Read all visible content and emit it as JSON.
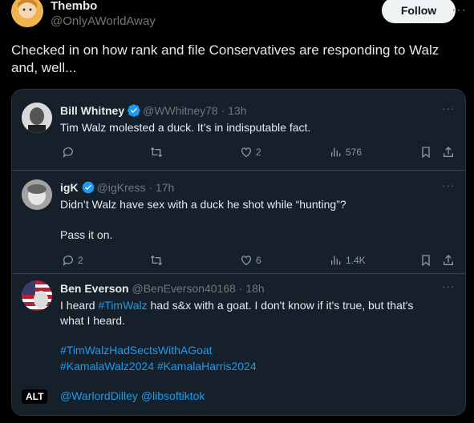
{
  "author": {
    "name": "Thembo",
    "handle": "@OnlyAWorldAway",
    "follow_label": "Follow",
    "more_label": "···"
  },
  "post": {
    "text_line1": "Checked in on how rank and file Conservatives are responding to Walz",
    "text_line2": "and, well..."
  },
  "replies": [
    {
      "name": "Bill Whitney",
      "handle": "@WWhitney78",
      "time": "· 13h",
      "verified": true,
      "lines": [
        "Tim Walz molested a duck. It’s in indisputable fact."
      ],
      "stats": {
        "likes": "2",
        "views": "576"
      }
    },
    {
      "name": "igK",
      "handle": "@igKress",
      "time": "· 17h",
      "verified": true,
      "lines": [
        "Didn’t Walz have sex with a duck he shot while “hunting”?",
        "Pass it on."
      ],
      "stats": {
        "replies": "2",
        "likes": "6",
        "views": "1.4K"
      }
    },
    {
      "name": "Ben Everson",
      "handle": "@BenEverson40168",
      "time": "· 18h",
      "verified": false,
      "line1_pre": "I heard ",
      "line1_tag": "#TimWalz",
      "line1_post": " had s&x with a goat. I don't know if it's true, but that's",
      "line2": "what I heard.",
      "tags_line1": "#TimWalzHadSectsWithAGoat",
      "tags_line2": "#KamalaWalz2024 #KamalaHarris2024",
      "mentions": "@WarlordDilley @libsoftiktok"
    }
  ],
  "alt_label": "ALT",
  "colors": {
    "background": "#000000",
    "card": "#15202b",
    "link": "#1d9bf0",
    "muted": "#71767b",
    "verified": "#1d9bf0"
  }
}
